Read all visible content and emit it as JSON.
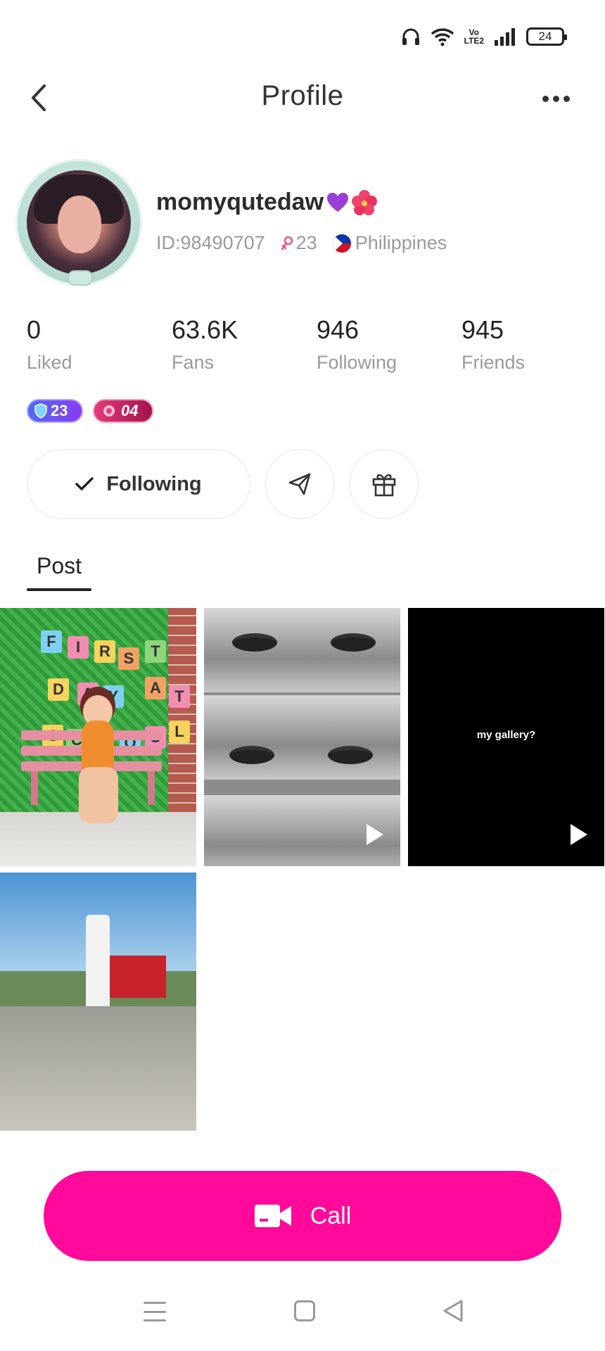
{
  "status_bar": {
    "battery": "24",
    "network_label_top": "Vo",
    "network_label_bottom": "LTE2",
    "icons": [
      "headphones-icon",
      "wifi-icon",
      "volte-icon",
      "signal-icon",
      "battery-icon"
    ]
  },
  "header": {
    "title": "Profile",
    "back_icon": "chevron-left-icon",
    "more_icon": "more-horizontal-icon"
  },
  "profile": {
    "username": "momyqutedaw",
    "id_text": "ID:98490707",
    "age": "23",
    "country": "Philippines",
    "gender_icon": "female-icon",
    "emojis": [
      "purple-heart-icon",
      "hibiscus-icon"
    ]
  },
  "stats": [
    {
      "value": "0",
      "label": "Liked"
    },
    {
      "value": "63.6K",
      "label": "Fans"
    },
    {
      "value": "946",
      "label": "Following"
    },
    {
      "value": "945",
      "label": "Friends"
    }
  ],
  "badges": {
    "level": "23",
    "vip": "04"
  },
  "actions": {
    "follow_label": "Following",
    "share_icon": "send-icon",
    "gift_icon": "gift-icon"
  },
  "tabs": {
    "post": "Post"
  },
  "posts": {
    "tile1_letters": [
      "F",
      "I",
      "R",
      "S",
      "T",
      "D",
      "A",
      "Y",
      "A",
      "T",
      "S",
      "C",
      "O",
      "O",
      "L"
    ],
    "tile3_caption": "my gallery?"
  },
  "call": {
    "label": "Call",
    "icon": "video-camera-icon"
  },
  "colors": {
    "accent": "#ff0a9b",
    "text_primary": "#222222",
    "text_secondary": "#9a9a9a"
  }
}
